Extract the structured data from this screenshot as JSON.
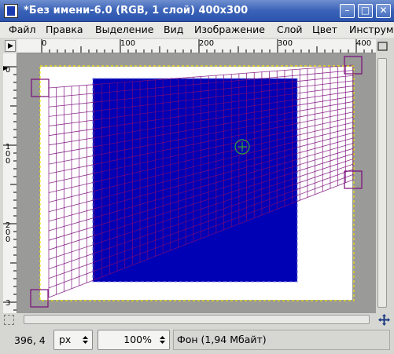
{
  "window": {
    "title": "*Без имени-6.0 (RGB, 1 слой) 400x300",
    "icon": "gimp-image-icon",
    "buttons": [
      "minimize-icon",
      "maximize-icon",
      "close-icon"
    ]
  },
  "menubar": {
    "items": [
      {
        "label": "Файл",
        "mnemonic": "Ф"
      },
      {
        "label": "Правка",
        "mnemonic": "П"
      },
      {
        "label": "Выделение",
        "mnemonic": "В"
      },
      {
        "label": "Вид",
        "mnemonic": "В"
      },
      {
        "label": "Изображение",
        "mnemonic": "И"
      },
      {
        "label": "Слой",
        "mnemonic": "С"
      },
      {
        "label": "Цвет",
        "mnemonic": "Ц"
      },
      {
        "label": "Инструм",
        "mnemonic": "И"
      }
    ]
  },
  "rulers": {
    "horizontal": [
      "0",
      "100",
      "200",
      "300",
      "400"
    ],
    "vertical": [
      "0",
      "100",
      "200",
      "3"
    ]
  },
  "statusbar": {
    "coords": "396, 4",
    "unit": "px",
    "zoom": "100%",
    "info": "Фон (1,94 Мбайт)"
  },
  "colors": {
    "fill": "#0000b4",
    "grid": "#7a0a7a",
    "selection": "#f4e400",
    "handle": "#7a0a7a"
  }
}
